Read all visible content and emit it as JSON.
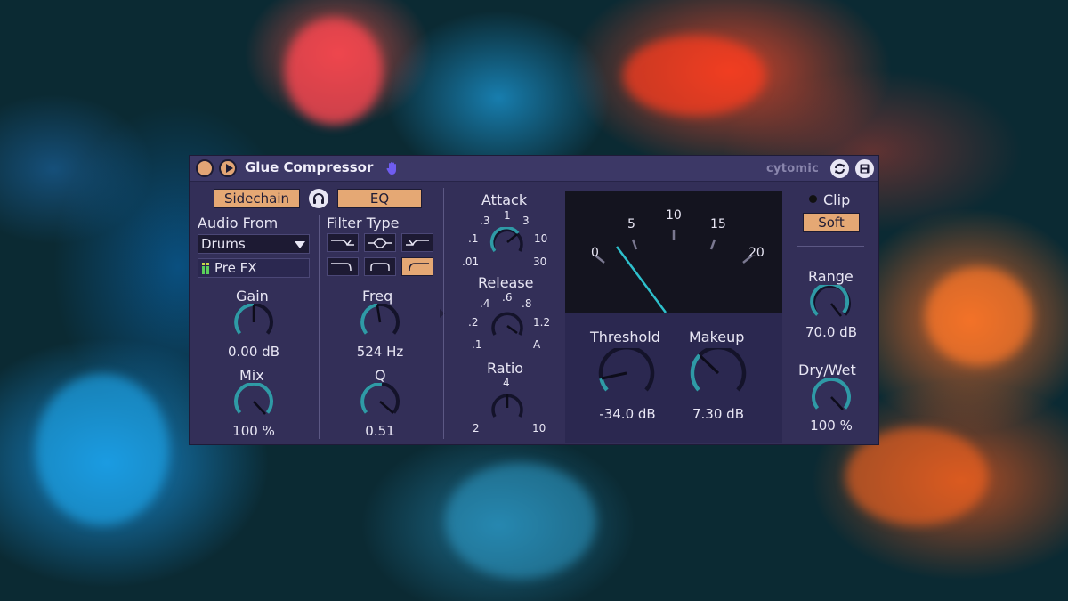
{
  "plugin": {
    "title": "Glue Compressor",
    "brand": "cytomic",
    "accent_color": "#e5a874",
    "knob_color": "#2f9aa6"
  },
  "titlebar_icons": [
    "power-icon",
    "play-icon",
    "hand-icon",
    "sync-icon",
    "save-icon"
  ],
  "sidechain": {
    "sidechain_label": "Sidechain",
    "eq_label": "EQ",
    "audio_from_label": "Audio From",
    "audio_from_value": "Drums",
    "tap_value": "Pre FX",
    "gain_label": "Gain",
    "gain_value": "0.00 dB",
    "mix_label": "Mix",
    "mix_value": "100 %"
  },
  "eq": {
    "filter_type_label": "Filter Type",
    "filter_types": [
      "low-pass",
      "band-pass",
      "high-pass",
      "low-shelf",
      "peak",
      "high-shelf"
    ],
    "active_filter": "high-shelf",
    "freq_label": "Freq",
    "freq_value": "524 Hz",
    "q_label": "Q",
    "q_value": "0.51"
  },
  "attack": {
    "label": "Attack",
    "ticks": [
      ".01",
      ".1",
      ".3",
      "1",
      "3",
      "10",
      "30"
    ]
  },
  "release": {
    "label": "Release",
    "ticks": [
      ".1",
      ".2",
      ".4",
      ".6",
      ".8",
      "1.2",
      "A"
    ]
  },
  "ratio": {
    "label": "Ratio",
    "ticks": [
      "2",
      "4",
      "10"
    ]
  },
  "meter": {
    "scale": [
      "0",
      "5",
      "10",
      "15",
      "20"
    ],
    "needle_value": 1
  },
  "compressor": {
    "threshold_label": "Threshold",
    "threshold_value": "-34.0 dB",
    "makeup_label": "Makeup",
    "makeup_value": "7.30 dB"
  },
  "output": {
    "clip_label": "Clip",
    "clip_mode": "Soft",
    "range_label": "Range",
    "range_value": "70.0 dB",
    "drywet_label": "Dry/Wet",
    "drywet_value": "100 %"
  }
}
